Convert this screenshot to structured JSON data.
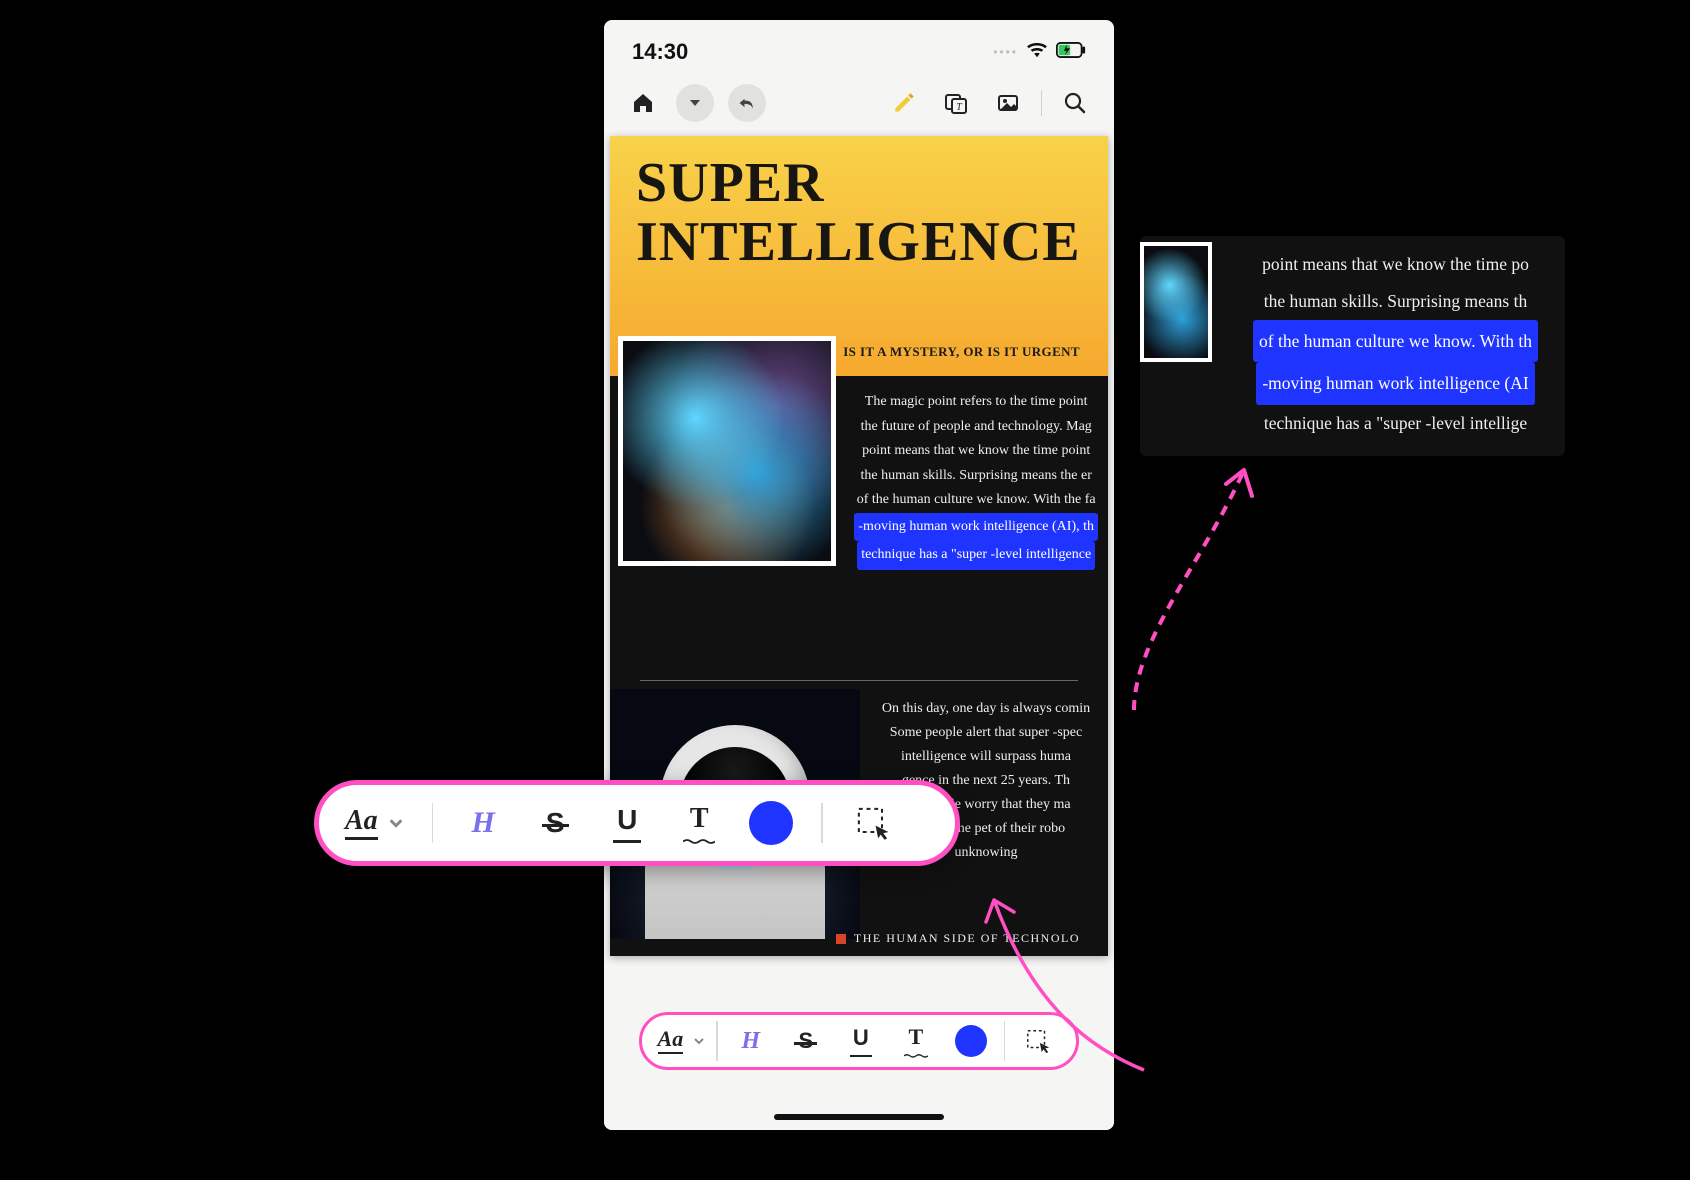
{
  "status_bar": {
    "time": "14:30"
  },
  "colors": {
    "accent_pink": "#ff4fc2",
    "highlight_blue": "#1f35ff",
    "toolbar_h": "#7b6fec"
  },
  "article": {
    "title_line1": "SUPER",
    "title_line2": "INTELLIGENCE",
    "subtitle": "IS IT A MYSTERY, OR IS IT URGENT",
    "p1": [
      "The magic point refers to the time point",
      "the future of people and technology. Mag",
      "point means that we know the time point",
      "the human skills. Surprising means the er",
      "of the human culture we know. With the fa",
      "-moving human work intelligence (AI), th",
      "technique has a \"super -level intelligence"
    ],
    "p1_highlight_start_index": 5,
    "p2": [
      "On this day, one day is always comin",
      "Some people alert that super -spec",
      "intelligence will surpass huma",
      "gence in the next 25 years. Th",
      "kes people worry that they ma",
      "become the pet of their robo",
      "unknowing"
    ],
    "footer_tag": "THE HUMAN SIDE OF TECHNOLO"
  },
  "popup": {
    "lines": [
      "point means that we know the time po",
      "the human skills. Surprising means th",
      "of the human culture we know. With th",
      "-moving human work intelligence (AI",
      "technique has a \"super -level intellige"
    ],
    "highlight_indices": [
      2,
      3
    ]
  },
  "toolbar": {
    "font_label": "Aa",
    "highlight_label": "H",
    "strike_label": "S",
    "underline_label": "U",
    "squiggle_label": "T"
  }
}
